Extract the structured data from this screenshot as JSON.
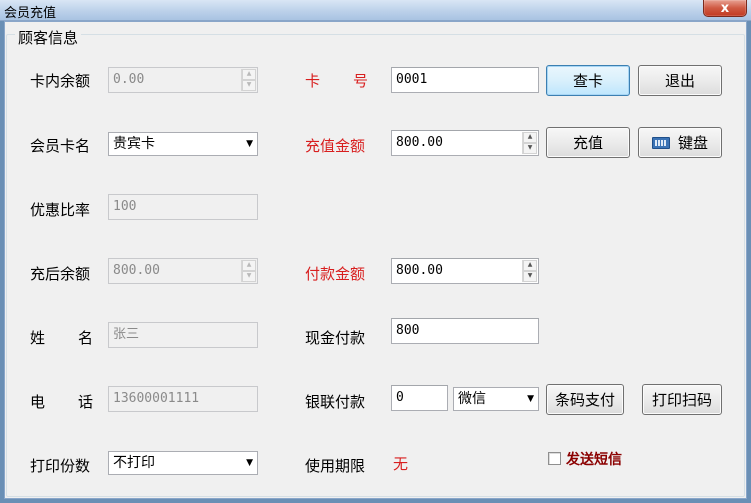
{
  "window": {
    "title": "会员充值",
    "close_glyph": "x"
  },
  "group": {
    "title": "顾客信息"
  },
  "labels": {
    "balance": "卡内余额",
    "card_name": "会员卡名",
    "discount": "优惠比率",
    "after_balance": "充后余额",
    "name_a": "姓",
    "name_b": "名",
    "phone_a": "电",
    "phone_b": "话",
    "print_copies": "打印份数",
    "card_no_a": "卡",
    "card_no_b": "号",
    "recharge_amount": "充值金额",
    "pay_amount": "付款金额",
    "cash_pay": "现金付款",
    "unionpay": "银联付款",
    "validity": "使用期限",
    "validity_value": "无"
  },
  "fields": {
    "balance": "0.00",
    "card_name": "贵宾卡",
    "discount": "100",
    "after_balance": "800.00",
    "name": "张三",
    "phone": "13600001111",
    "print_copies": "不打印",
    "card_no": "0001",
    "recharge_amount": "800.00",
    "pay_amount": "800.00",
    "cash_pay": "800",
    "unionpay": "0",
    "pay_method": "微信"
  },
  "buttons": {
    "query_card": "查卡",
    "exit": "退出",
    "recharge": "充值",
    "keyboard": "键盘",
    "barcode_pay": "条码支付",
    "print_scan": "打印扫码"
  },
  "checkbox": {
    "send_sms": "发送短信",
    "checked": false
  },
  "icons": {
    "keyboard": "keyboard-icon",
    "dropdown": "▼",
    "spin_up": "▲",
    "spin_down": "▼"
  },
  "colors": {
    "required_label": "#d81e1e",
    "sms_label": "#8b0000"
  }
}
